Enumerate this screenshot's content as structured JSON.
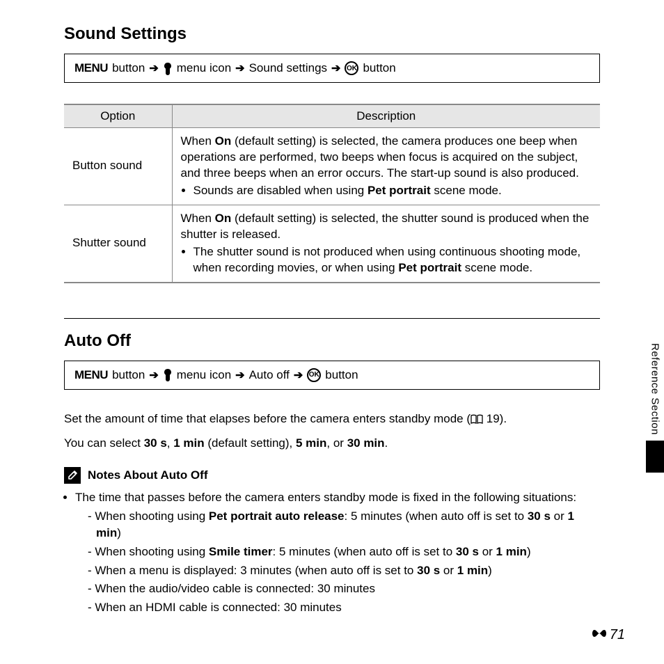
{
  "section1": {
    "heading": "Sound Settings",
    "nav": {
      "menu_word": "MENU",
      "step1": "button",
      "step2": "menu icon",
      "step3": "Sound settings",
      "step4": "button"
    },
    "table": {
      "headers": {
        "option": "Option",
        "description": "Description"
      },
      "rows": [
        {
          "option": "Button sound",
          "desc_pre": "When ",
          "desc_bold1": "On",
          "desc_mid": " (default setting) is selected, the camera produces one beep when operations are performed, two beeps when focus is acquired on the subject, and three beeps when an error occurs. The start-up sound is also produced.",
          "bullet_pre": "Sounds are disabled when using ",
          "bullet_bold": "Pet portrait",
          "bullet_post": " scene mode."
        },
        {
          "option": "Shutter sound",
          "desc_pre": "When ",
          "desc_bold1": "On",
          "desc_mid": " (default setting) is selected, the shutter sound is produced when the shutter is released.",
          "bullet_pre": "The shutter sound is not produced when using continuous shooting mode, when recording movies, or when using ",
          "bullet_bold": "Pet portrait",
          "bullet_post": " scene mode."
        }
      ]
    }
  },
  "section2": {
    "heading": "Auto Off",
    "nav": {
      "menu_word": "MENU",
      "step1": "button",
      "step2": "menu icon",
      "step3": "Auto off",
      "step4": "button"
    },
    "intro1_pre": "Set the amount of time that elapses before the camera enters standby mode (",
    "intro1_ref": "19",
    "intro1_post": ").",
    "intro2_pre": "You can select ",
    "intro2_b1": "30 s",
    "intro2_sep1": ", ",
    "intro2_b2": "1 min",
    "intro2_mid": " (default setting), ",
    "intro2_b3": "5 min",
    "intro2_sep2": ", or ",
    "intro2_b4": "30 min",
    "intro2_post": ".",
    "notes_title": "Notes About Auto Off",
    "note_intro": "The time that passes before the camera enters standby mode is fixed in the following situations:",
    "dash_items": [
      {
        "pre": "When shooting using ",
        "b1": "Pet portrait auto release",
        "mid": ": 5 minutes (when auto off is set to ",
        "b2": "30 s",
        "sep": " or ",
        "b3": "1 min",
        "post": ")"
      },
      {
        "pre": "When shooting using ",
        "b1": "Smile timer",
        "mid": ": 5 minutes (when auto off is set to ",
        "b2": "30 s",
        "sep": " or ",
        "b3": "1 min",
        "post": ")"
      },
      {
        "pre": "When a menu is displayed: 3 minutes (when auto off is set to ",
        "b1": "30 s",
        "sep": " or ",
        "b2": "1 min",
        "post": ")"
      },
      {
        "pre": "When the audio/video cable is connected: 30 minutes"
      },
      {
        "pre": "When an HDMI cable is connected: 30 minutes"
      }
    ]
  },
  "side_label": "Reference Section",
  "page_number": "71"
}
